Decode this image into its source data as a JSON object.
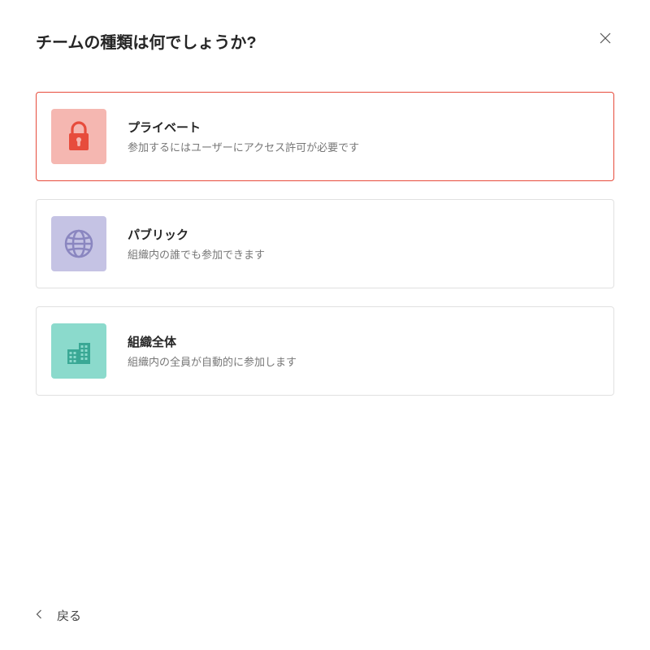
{
  "dialog": {
    "title": "チームの種類は何でしょうか?",
    "back_label": "戻る"
  },
  "options": {
    "private": {
      "title": "プライベート",
      "desc": "参加するにはユーザーにアクセス許可が必要です"
    },
    "public": {
      "title": "パブリック",
      "desc": "組織内の誰でも参加できます"
    },
    "org": {
      "title": "組織全体",
      "desc": "組織内の全員が自動的に参加します"
    }
  },
  "colors": {
    "selected_border": "#e74c3c",
    "private_bg": "#f5b7b1",
    "public_bg": "#c5c3e4",
    "org_bg": "#8bdacc",
    "lock_color": "#e74c3c",
    "globe_color": "#8a86c0",
    "building_color": "#3aa895"
  }
}
